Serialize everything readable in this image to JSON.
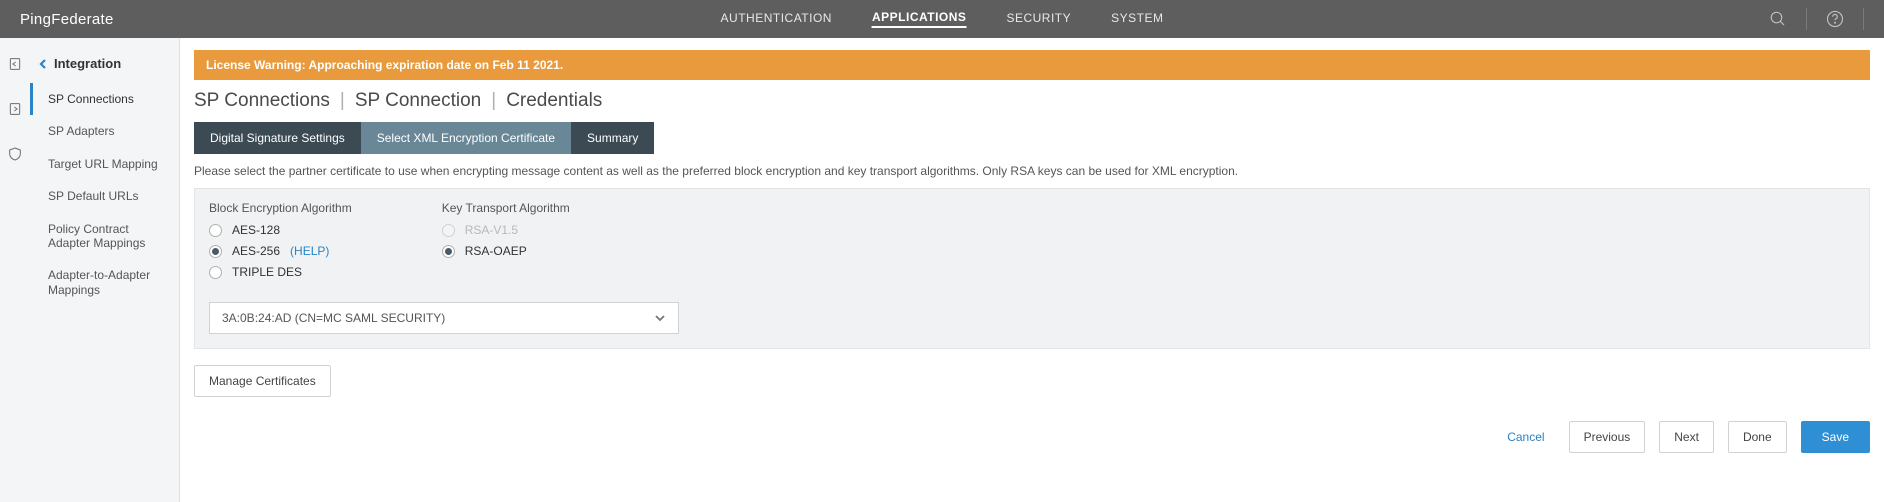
{
  "brand_a": "Ping",
  "brand_b": "Federate",
  "topnav": [
    "AUTHENTICATION",
    "APPLICATIONS",
    "SECURITY",
    "SYSTEM"
  ],
  "topnav_active_index": 1,
  "sidebar": {
    "head": "Integration",
    "items": [
      "SP Connections",
      "SP Adapters",
      "Target URL Mapping",
      "SP Default URLs",
      "Policy Contract Adapter Mappings",
      "Adapter-to-Adapter Mappings"
    ],
    "active_index": 0
  },
  "warning": "License Warning: Approaching expiration date on Feb 11 2021.",
  "crumbs": [
    "SP Connections",
    "SP Connection",
    "Credentials"
  ],
  "tabs": [
    {
      "label": "Digital Signature Settings",
      "sel": false
    },
    {
      "label": "Select XML Encryption Certificate",
      "sel": true
    },
    {
      "label": "Summary",
      "sel": false
    }
  ],
  "desc": "Please select the partner certificate to use when encrypting message content as well as the preferred block encryption and key transport algorithms. Only RSA keys can be used for XML encryption.",
  "block": {
    "title": "Block Encryption Algorithm",
    "options": [
      {
        "label": "AES-128",
        "checked": false,
        "disabled": false,
        "help": null
      },
      {
        "label": "AES-256",
        "checked": true,
        "disabled": false,
        "help": "(HELP)"
      },
      {
        "label": "TRIPLE DES",
        "checked": false,
        "disabled": false,
        "help": null
      }
    ]
  },
  "transport": {
    "title": "Key Transport Algorithm",
    "options": [
      {
        "label": "RSA-V1.5",
        "checked": false,
        "disabled": true,
        "help": null
      },
      {
        "label": "RSA-OAEP",
        "checked": true,
        "disabled": false,
        "help": null
      }
    ]
  },
  "cert_select": "3A:0B:24:AD (CN=MC SAML SECURITY)",
  "manage_btn": "Manage Certificates",
  "footer": {
    "cancel": "Cancel",
    "previous": "Previous",
    "next": "Next",
    "done": "Done",
    "save": "Save"
  }
}
